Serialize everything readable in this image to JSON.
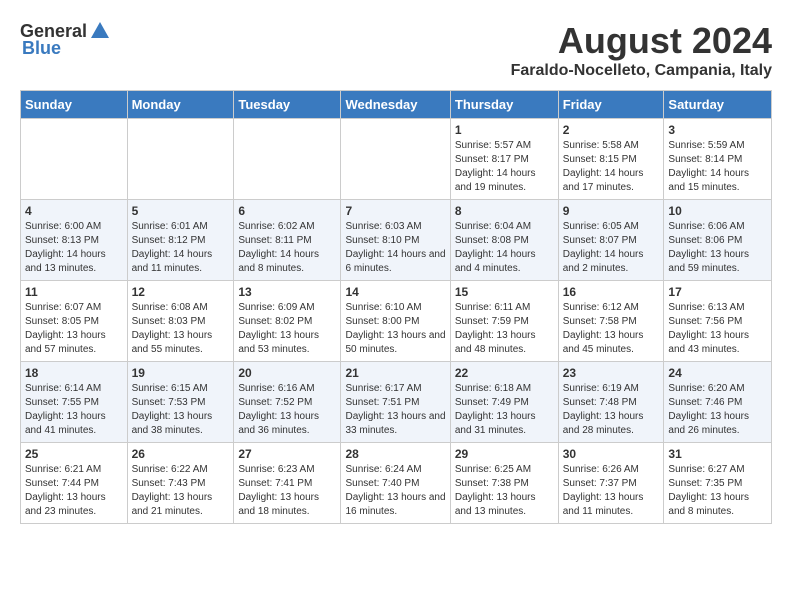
{
  "header": {
    "logo_general": "General",
    "logo_blue": "Blue",
    "month_year": "August 2024",
    "location": "Faraldo-Nocelleto, Campania, Italy"
  },
  "days_of_week": [
    "Sunday",
    "Monday",
    "Tuesday",
    "Wednesday",
    "Thursday",
    "Friday",
    "Saturday"
  ],
  "weeks": [
    [
      {
        "day": "",
        "info": ""
      },
      {
        "day": "",
        "info": ""
      },
      {
        "day": "",
        "info": ""
      },
      {
        "day": "",
        "info": ""
      },
      {
        "day": "1",
        "info": "Sunrise: 5:57 AM\nSunset: 8:17 PM\nDaylight: 14 hours and 19 minutes."
      },
      {
        "day": "2",
        "info": "Sunrise: 5:58 AM\nSunset: 8:15 PM\nDaylight: 14 hours and 17 minutes."
      },
      {
        "day": "3",
        "info": "Sunrise: 5:59 AM\nSunset: 8:14 PM\nDaylight: 14 hours and 15 minutes."
      }
    ],
    [
      {
        "day": "4",
        "info": "Sunrise: 6:00 AM\nSunset: 8:13 PM\nDaylight: 14 hours and 13 minutes."
      },
      {
        "day": "5",
        "info": "Sunrise: 6:01 AM\nSunset: 8:12 PM\nDaylight: 14 hours and 11 minutes."
      },
      {
        "day": "6",
        "info": "Sunrise: 6:02 AM\nSunset: 8:11 PM\nDaylight: 14 hours and 8 minutes."
      },
      {
        "day": "7",
        "info": "Sunrise: 6:03 AM\nSunset: 8:10 PM\nDaylight: 14 hours and 6 minutes."
      },
      {
        "day": "8",
        "info": "Sunrise: 6:04 AM\nSunset: 8:08 PM\nDaylight: 14 hours and 4 minutes."
      },
      {
        "day": "9",
        "info": "Sunrise: 6:05 AM\nSunset: 8:07 PM\nDaylight: 14 hours and 2 minutes."
      },
      {
        "day": "10",
        "info": "Sunrise: 6:06 AM\nSunset: 8:06 PM\nDaylight: 13 hours and 59 minutes."
      }
    ],
    [
      {
        "day": "11",
        "info": "Sunrise: 6:07 AM\nSunset: 8:05 PM\nDaylight: 13 hours and 57 minutes."
      },
      {
        "day": "12",
        "info": "Sunrise: 6:08 AM\nSunset: 8:03 PM\nDaylight: 13 hours and 55 minutes."
      },
      {
        "day": "13",
        "info": "Sunrise: 6:09 AM\nSunset: 8:02 PM\nDaylight: 13 hours and 53 minutes."
      },
      {
        "day": "14",
        "info": "Sunrise: 6:10 AM\nSunset: 8:00 PM\nDaylight: 13 hours and 50 minutes."
      },
      {
        "day": "15",
        "info": "Sunrise: 6:11 AM\nSunset: 7:59 PM\nDaylight: 13 hours and 48 minutes."
      },
      {
        "day": "16",
        "info": "Sunrise: 6:12 AM\nSunset: 7:58 PM\nDaylight: 13 hours and 45 minutes."
      },
      {
        "day": "17",
        "info": "Sunrise: 6:13 AM\nSunset: 7:56 PM\nDaylight: 13 hours and 43 minutes."
      }
    ],
    [
      {
        "day": "18",
        "info": "Sunrise: 6:14 AM\nSunset: 7:55 PM\nDaylight: 13 hours and 41 minutes."
      },
      {
        "day": "19",
        "info": "Sunrise: 6:15 AM\nSunset: 7:53 PM\nDaylight: 13 hours and 38 minutes."
      },
      {
        "day": "20",
        "info": "Sunrise: 6:16 AM\nSunset: 7:52 PM\nDaylight: 13 hours and 36 minutes."
      },
      {
        "day": "21",
        "info": "Sunrise: 6:17 AM\nSunset: 7:51 PM\nDaylight: 13 hours and 33 minutes."
      },
      {
        "day": "22",
        "info": "Sunrise: 6:18 AM\nSunset: 7:49 PM\nDaylight: 13 hours and 31 minutes."
      },
      {
        "day": "23",
        "info": "Sunrise: 6:19 AM\nSunset: 7:48 PM\nDaylight: 13 hours and 28 minutes."
      },
      {
        "day": "24",
        "info": "Sunrise: 6:20 AM\nSunset: 7:46 PM\nDaylight: 13 hours and 26 minutes."
      }
    ],
    [
      {
        "day": "25",
        "info": "Sunrise: 6:21 AM\nSunset: 7:44 PM\nDaylight: 13 hours and 23 minutes."
      },
      {
        "day": "26",
        "info": "Sunrise: 6:22 AM\nSunset: 7:43 PM\nDaylight: 13 hours and 21 minutes."
      },
      {
        "day": "27",
        "info": "Sunrise: 6:23 AM\nSunset: 7:41 PM\nDaylight: 13 hours and 18 minutes."
      },
      {
        "day": "28",
        "info": "Sunrise: 6:24 AM\nSunset: 7:40 PM\nDaylight: 13 hours and 16 minutes."
      },
      {
        "day": "29",
        "info": "Sunrise: 6:25 AM\nSunset: 7:38 PM\nDaylight: 13 hours and 13 minutes."
      },
      {
        "day": "30",
        "info": "Sunrise: 6:26 AM\nSunset: 7:37 PM\nDaylight: 13 hours and 11 minutes."
      },
      {
        "day": "31",
        "info": "Sunrise: 6:27 AM\nSunset: 7:35 PM\nDaylight: 13 hours and 8 minutes."
      }
    ]
  ]
}
